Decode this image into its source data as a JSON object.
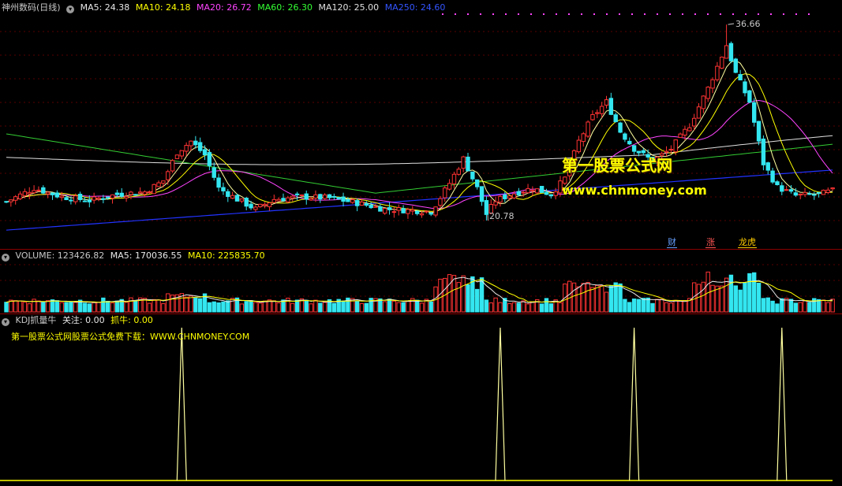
{
  "colors": {
    "up": "#ff3333",
    "down": "#33e6f0",
    "ma5": "#ffffa0",
    "ma10": "#ffff00",
    "ma20": "#ff44ff",
    "ma60": "#33cc33",
    "ma120": "#e0e0e0",
    "ma250": "#2233ff",
    "grid": "#5a0000"
  },
  "price_header": {
    "stock_name": "神州数码(日线)",
    "ma5": "MA5: 24.38",
    "ma10": "MA10: 24.18",
    "ma20": "MA20: 26.72",
    "ma60": "MA60: 26.30",
    "ma120": "MA120: 25.00",
    "ma250": "MA250: 24.60"
  },
  "annotations": {
    "high_label": "36.66",
    "low_label": "20.78"
  },
  "watermark": {
    "title": "第一股票公式网",
    "url": "www.chnmoney.com"
  },
  "badges": {
    "cai": "财",
    "zhang": "涨",
    "longhu": "龙虎"
  },
  "volume_header": {
    "volume": "VOLUME: 123426.82",
    "ma5": "MA5: 170036.55",
    "ma10": "MA10: 225835.70"
  },
  "kdj_header": {
    "name": "KDJ抓量牛",
    "guanzhu": "关注: 0.00",
    "zhuaniu": "抓牛: 0.00"
  },
  "kdj_note": "第一股票公式网股票公式免费下载：WWW.CHNMONEY.COM",
  "chart_data": {
    "type": "candlestick",
    "price_range": [
      19.5,
      37.5
    ],
    "signals_at_bar": [
      38,
      107,
      136,
      168
    ]
  }
}
